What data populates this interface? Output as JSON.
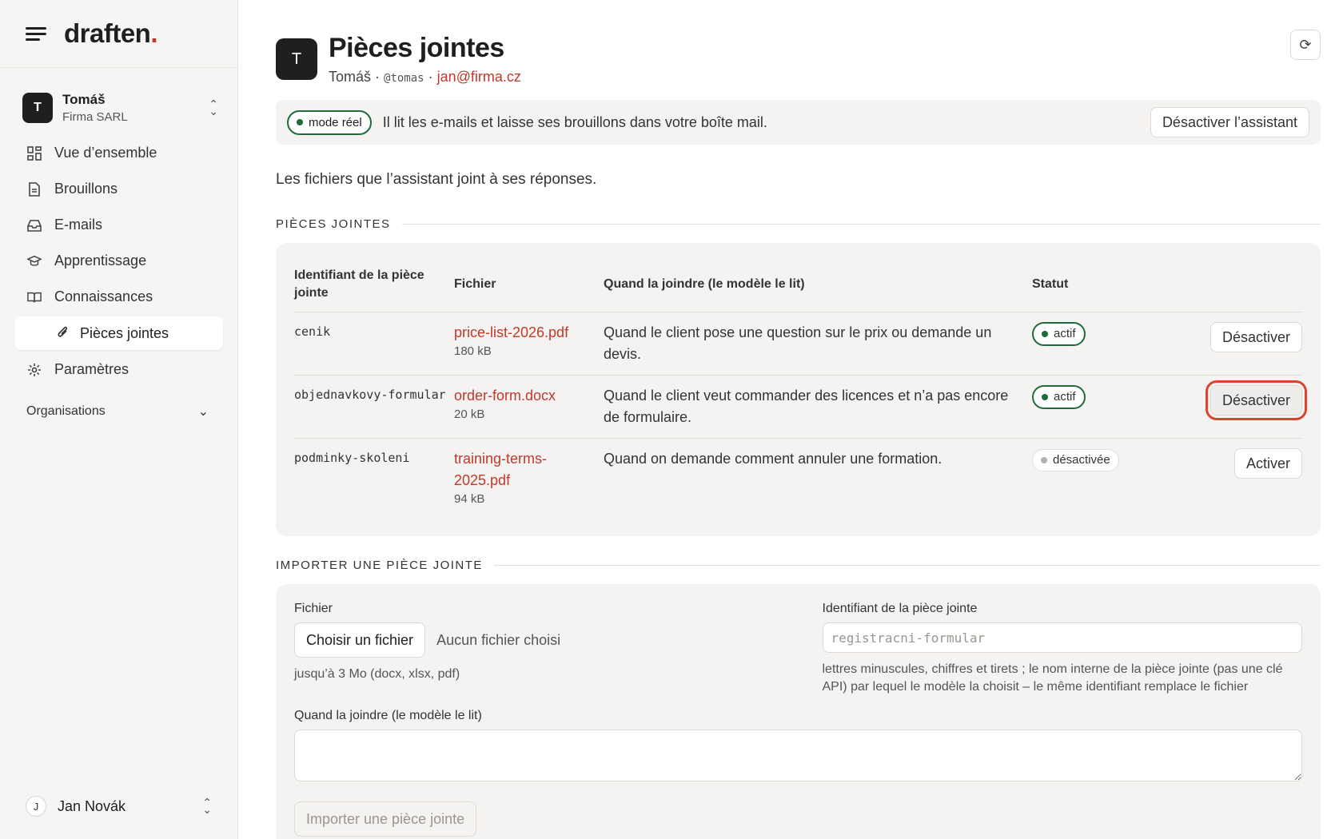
{
  "app": {
    "logo_text": "draften",
    "logo_dot": "."
  },
  "account": {
    "initial": "T",
    "name": "Tomáš",
    "org": "Firma SARL"
  },
  "nav": {
    "overview": "Vue d’ensemble",
    "drafts": "Brouillons",
    "emails": "E-mails",
    "learning": "Apprentissage",
    "knowledge": "Connaissances",
    "attachments": "Pièces jointes",
    "settings": "Paramètres"
  },
  "organisations_label": "Organisations",
  "user": {
    "initial": "J",
    "name": "Jan Novák"
  },
  "header": {
    "initial": "T",
    "title": "Pièces jointes",
    "name": "Tomáš",
    "sep": " · ",
    "handle": "@tomas",
    "email": "jan@firma.cz"
  },
  "banner": {
    "mode": "mode réel",
    "text": "Il lit les e-mails et laisse ses brouillons dans votre boîte mail.",
    "deactivate": "Désactiver l’assistant"
  },
  "intro": "Les fichiers que l’assistant joint à ses réponses.",
  "attachments_section": {
    "title": "PIÈCES JOINTES",
    "columns": {
      "id": "Identifiant de la pièce jointe",
      "file": "Fichier",
      "when": "Quand la joindre (le modèle le lit)",
      "status": "Statut"
    },
    "rows": [
      {
        "id": "cenik",
        "file": "price-list-2026.pdf",
        "size": "180 kB",
        "when": "Quand le client pose une question sur le prix ou demande un devis.",
        "status": "actif",
        "action": "Désactiver"
      },
      {
        "id": "objednavkovy-formular",
        "file": "order-form.docx",
        "size": "20 kB",
        "when": "Quand le client veut commander des licences et n’a pas encore de formulaire.",
        "status": "actif",
        "action": "Désactiver"
      },
      {
        "id": "podminky-skoleni",
        "file": "training-terms-2025.pdf",
        "size": "94 kB",
        "when": "Quand on demande comment annuler une formation.",
        "status": "désactivée",
        "action": "Activer"
      }
    ]
  },
  "import_section": {
    "title": "IMPORTER UNE PIÈCE JOINTE",
    "file_label": "Fichier",
    "choose_file": "Choisir un fichier",
    "no_file": "Aucun fichier choisi",
    "file_hint": "jusqu’à 3 Mo (docx, xlsx, pdf)",
    "id_label": "Identifiant de la pièce jointe",
    "id_placeholder": "registracni-formular",
    "id_hint": "lettres minuscules, chiffres et tirets ; le nom interne de la pièce jointe (pas une clé API) par lequel le modèle la choisit – le même identifiant remplace le fichier",
    "when_label": "Quand la joindre (le modèle le lit)",
    "when_value": "",
    "submit": "Importer une pièce jointe"
  },
  "colors": {
    "accent": "#c0392b",
    "active_green": "#1f6b3a",
    "focus_ring": "#d9442f"
  }
}
